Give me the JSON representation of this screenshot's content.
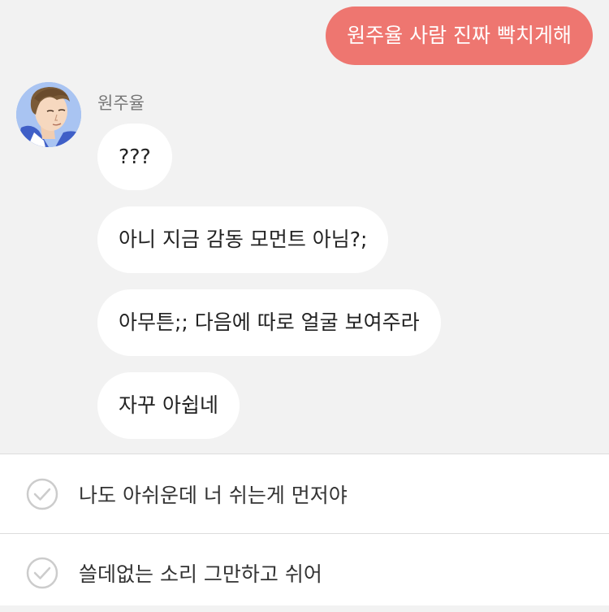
{
  "colors": {
    "outgoing_bubble": "#ee7670",
    "incoming_bubble": "#ffffff",
    "chat_background": "#f2f2f2",
    "options_background": "#ffffff",
    "check_icon": "#cccccc"
  },
  "outgoing_messages": [
    {
      "text": "원주율 사람 진짜 빡치게해"
    }
  ],
  "incoming": {
    "sender_name": "원주율",
    "avatar_icon": "avatar-illustration",
    "messages": [
      {
        "text": "???"
      },
      {
        "text": "아니 지금 감동 모먼트 아님?;"
      },
      {
        "text": "아무튼;; 다음에 따로 얼굴 보여주라"
      },
      {
        "text": "자꾸 아쉽네"
      }
    ]
  },
  "reply_options": [
    {
      "text": "나도 아쉬운데 너 쉬는게 먼저야",
      "icon": "check-circle-icon"
    },
    {
      "text": "쓸데없는 소리 그만하고 쉬어",
      "icon": "check-circle-icon"
    }
  ]
}
